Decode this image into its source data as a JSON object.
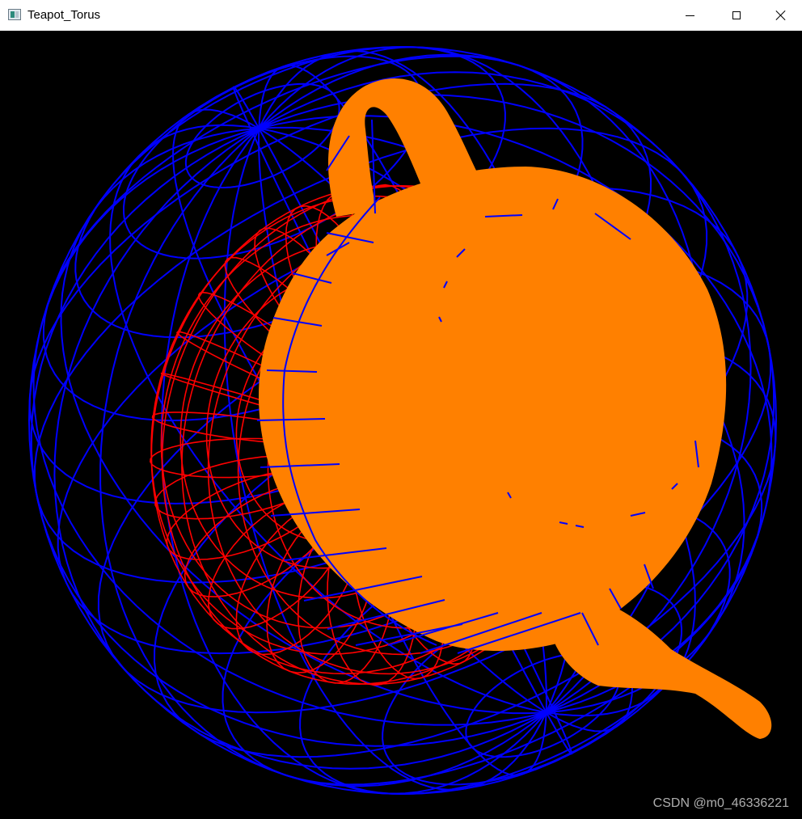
{
  "window": {
    "title": "Teapot_Torus",
    "icon": "app-window-icon",
    "controls": {
      "minimize_icon": "minimize-icon",
      "maximize_icon": "maximize-icon",
      "close_icon": "close-icon"
    }
  },
  "scene": {
    "background_color": "#000000",
    "sphere": {
      "style": "wireframe",
      "color": "#0000ff"
    },
    "torus": {
      "style": "wireframe",
      "color": "#ff0000"
    },
    "teapot": {
      "style": "solid",
      "color": "#ff8000"
    }
  },
  "watermark": "CSDN @m0_46336221"
}
